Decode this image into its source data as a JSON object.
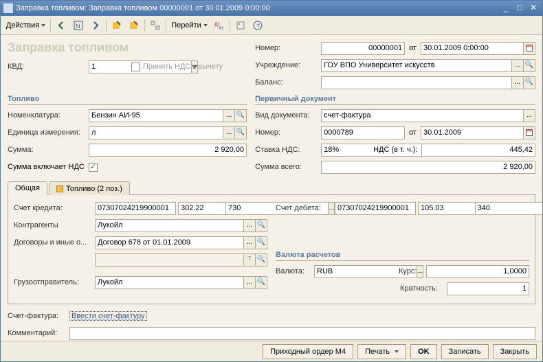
{
  "window": {
    "title": "Заправка топливом: Заправка топливом 00000001 от 30.01.2009 0:00:00"
  },
  "toolbar": {
    "actions": "Действия",
    "goto": "Перейти"
  },
  "page_title": "Заправка топливом",
  "left": {
    "kvd_label": "КВД:",
    "kvd_value": "1",
    "vat_deduct": "Принять НДС к вычету",
    "fuel_section": "Топливо",
    "nomenclature_label": "Номенклатура:",
    "nomenclature_value": "Бензин АИ-95",
    "unit_label": "Единица измерения:",
    "unit_value": "л",
    "sum_label": "Сумма:",
    "sum_value": "2 920,00",
    "sum_includes_vat": "Сумма включает НДС"
  },
  "right": {
    "number_label": "Номер:",
    "number_value": "00000001",
    "from": "от",
    "date_value": "30.01.2009 0:00:00",
    "institution_label": "Учреждение:",
    "institution_value": "ГОУ ВПО Университет искусств",
    "balance_label": "Баланс:",
    "balance_value": "",
    "primary_doc_section": "Первичный документ",
    "doc_type_label": "Вид документа:",
    "doc_type_value": "счет-фактура",
    "doc_number_label": "Номер:",
    "doc_number_value": "0000789",
    "doc_date_value": "30.01.2009",
    "vat_rate_label": "Ставка НДС:",
    "vat_rate_value": "18%",
    "vat_amount_label": "НДС (в т. ч.):",
    "vat_amount_value": "445,42",
    "total_label": "Сумма всего:",
    "total_value": "2 920,00"
  },
  "tabs": {
    "general": "Общая",
    "fuel": "Топливо (2 поз.)"
  },
  "general_tab": {
    "credit_account_label": "Счет кредита:",
    "credit_account_value": "07307024219900001",
    "credit_sub1": "302.22",
    "credit_sub2": "730",
    "debit_account_label": "Счет дебета:",
    "debit_account_value": "07307024219900001",
    "debit_sub1": "105.03",
    "debit_sub2": "340",
    "counterparty_label": "Контрагенты",
    "counterparty_value": "Лукойл",
    "contracts_label": "Договоры и иные о...",
    "contracts_value": "Договор 678 от 01.01.2009",
    "currency_section": "Валюта расчетов",
    "currency_label": "Валюта:",
    "currency_value": "RUB",
    "rate_label": "Курс:",
    "rate_value": "1,0000",
    "shipper_label": "Грузоотправитель:",
    "shipper_value": "Лукойл",
    "multiplicity_label": "Кратность:",
    "multiplicity_value": "1"
  },
  "bottom": {
    "invoice_label": "Счет-фактура:",
    "invoice_link": "Ввести счет-фактуру",
    "comment_label": "Комментарий:"
  },
  "footer": {
    "order_m4": "Приходный ордер М4",
    "print": "Печать",
    "ok": "OK",
    "save": "Записать",
    "close": "Закрыть"
  }
}
